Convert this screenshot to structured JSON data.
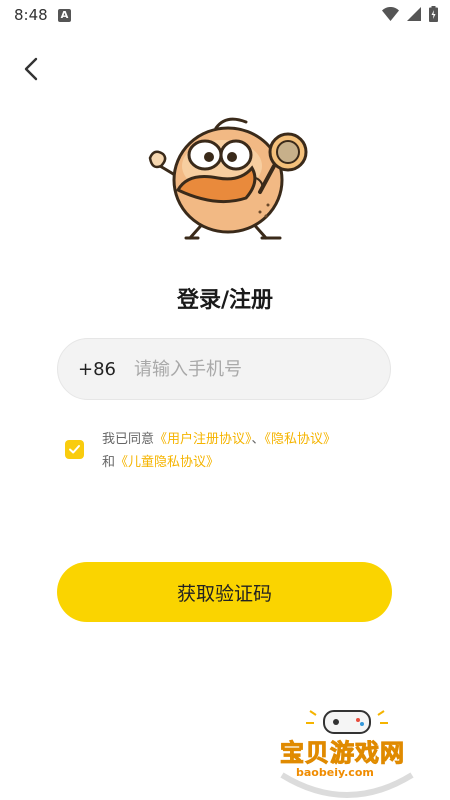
{
  "status_bar": {
    "time": "8:48",
    "notification_letter": "A"
  },
  "title": "登录/注册",
  "phone": {
    "country_code": "+86",
    "placeholder": "请输入手机号",
    "value": ""
  },
  "agreement": {
    "checked": true,
    "prefix": "我已同意",
    "user_agreement": "《用户注册协议》",
    "separator": "、",
    "privacy_agreement": "《隐私协议》",
    "and": "和",
    "child_privacy": "《儿童隐私协议》"
  },
  "get_code_button": "获取验证码",
  "watermark": {
    "main": "宝贝游戏网",
    "sub": "baobeiy.com"
  },
  "colors": {
    "accent": "#fad400",
    "link": "#f5b400"
  },
  "icons": {
    "back": "chevron-left-icon",
    "wifi": "wifi-icon",
    "signal": "signal-icon",
    "battery": "battery-icon",
    "check": "check-icon"
  }
}
